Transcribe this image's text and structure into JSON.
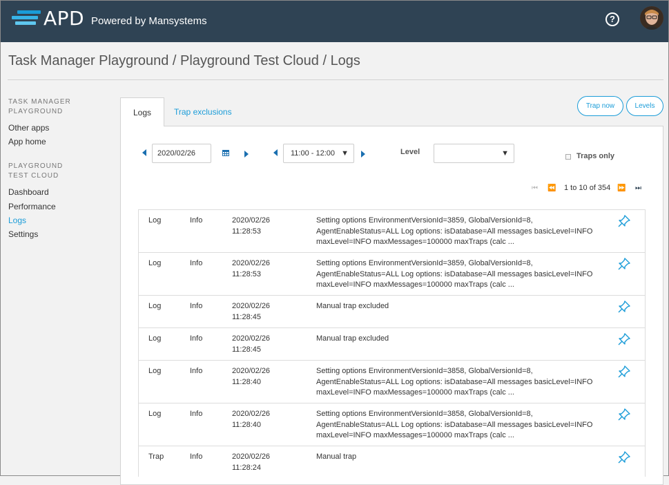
{
  "header": {
    "logo": "APD",
    "powered_by": "Powered by Mansystems",
    "help_icon": "?",
    "colors": {
      "bar": "#2f4354",
      "logo_stripes": [
        "#1a9cd8",
        "#38b4e8",
        "#5fc7ef"
      ]
    }
  },
  "page": {
    "title": "Task Manager Playground / Playground Test Cloud / Logs"
  },
  "sidebar": {
    "section1": {
      "heading": "TASK MANAGER PLAYGROUND",
      "items": [
        {
          "label": "Other apps"
        },
        {
          "label": "App home"
        }
      ]
    },
    "section2": {
      "heading": "PLAYGROUND TEST CLOUD",
      "items": [
        {
          "label": "Dashboard"
        },
        {
          "label": "Performance"
        },
        {
          "label": "Logs",
          "active": true
        },
        {
          "label": "Settings"
        }
      ]
    }
  },
  "tabs": [
    {
      "label": "Logs",
      "active": true
    },
    {
      "label": "Trap exclusions"
    }
  ],
  "actions": {
    "trap_now": "Trap now",
    "levels": "Levels"
  },
  "filters": {
    "date": "2020/02/26",
    "time_range": "11:00 - 12:00",
    "level_label": "Level",
    "level_value": "",
    "traps_only_label": "Traps only",
    "traps_only_checked": false
  },
  "pager": {
    "text": "1 to 10 of 354"
  },
  "logs": [
    {
      "type": "Log",
      "level": "Info",
      "date": "2020/02/26",
      "time": "11:28:53",
      "message": "Setting options EnvironmentVersionId=3859, GlobalVersionId=8, AgentEnableStatus=ALL Log options: isDatabase=All messages basicLevel=INFO maxLevel=INFO maxMessages=100000 maxTraps (calc ..."
    },
    {
      "type": "Log",
      "level": "Info",
      "date": "2020/02/26",
      "time": "11:28:53",
      "message": "Setting options EnvironmentVersionId=3859, GlobalVersionId=8, AgentEnableStatus=ALL Log options: isDatabase=All messages basicLevel=INFO maxLevel=INFO maxMessages=100000 maxTraps (calc ..."
    },
    {
      "type": "Log",
      "level": "Info",
      "date": "2020/02/26",
      "time": "11:28:45",
      "message": "Manual trap excluded"
    },
    {
      "type": "Log",
      "level": "Info",
      "date": "2020/02/26",
      "time": "11:28:45",
      "message": "Manual trap excluded"
    },
    {
      "type": "Log",
      "level": "Info",
      "date": "2020/02/26",
      "time": "11:28:40",
      "message": "Setting options EnvironmentVersionId=3858, GlobalVersionId=8, AgentEnableStatus=ALL Log options: isDatabase=All messages basicLevel=INFO maxLevel=INFO maxMessages=100000 maxTraps (calc ..."
    },
    {
      "type": "Log",
      "level": "Info",
      "date": "2020/02/26",
      "time": "11:28:40",
      "message": "Setting options EnvironmentVersionId=3858, GlobalVersionId=8, AgentEnableStatus=ALL Log options: isDatabase=All messages basicLevel=INFO maxLevel=INFO maxMessages=100000 maxTraps (calc ..."
    },
    {
      "type": "Trap",
      "level": "Info",
      "date": "2020/02/26",
      "time": "11:28:24",
      "message": "Manual trap"
    }
  ]
}
